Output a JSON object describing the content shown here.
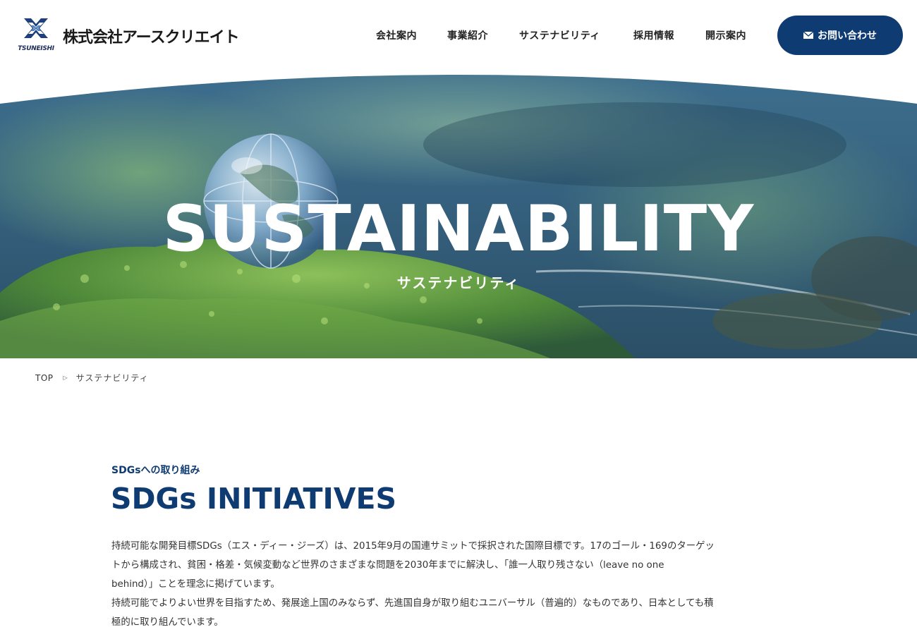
{
  "header": {
    "logo_text": "TSUNEISHI",
    "company_name": "株式会社アースクリエイト",
    "nav": [
      {
        "label": "会社案内"
      },
      {
        "label": "事業紹介"
      },
      {
        "label": "サステナビリティ"
      },
      {
        "label": "採用情報"
      },
      {
        "label": "開示案内"
      }
    ],
    "contact_label": "お問い合わせ"
  },
  "hero": {
    "title": "SUSTAINABILITY",
    "subtitle": "サステナビリティ"
  },
  "breadcrumb": {
    "home": "TOP",
    "current": "サステナビリティ"
  },
  "section": {
    "eyebrow": "SDGsへの取り組み",
    "title": "SDGs INITIATIVES",
    "paragraph1_line1": "持続可能な開発目標SDGs（エス・ディー・ジーズ）は、2015年9月の国連サミットで採択された国際目標です。17のゴール・169のターゲッ",
    "paragraph1_line2": "トから構成され、貧困・格差・気候変動など世界のさまざまな問題を2030年までに解決し、「誰一人取り残さない（leave no one",
    "paragraph1_line3": "behind）」ことを理念に掲げています。",
    "paragraph2_line1": "持続可能でよりよい世界を目指すため、発展途上国のみならず、先進国自身が取り組むユニバーサル（普遍的）なものであり、日本としても積",
    "paragraph2_line2": "極的に取り組んでいます。"
  },
  "colors": {
    "brand": "#0f3b73",
    "hero_tint": "#2f5d86",
    "moss": "#5a9a3a"
  },
  "icons": {
    "logo": "tsuneishi-x-logo-icon",
    "contact": "mail-icon",
    "breadcrumb_sep": "triangle-right-icon"
  }
}
